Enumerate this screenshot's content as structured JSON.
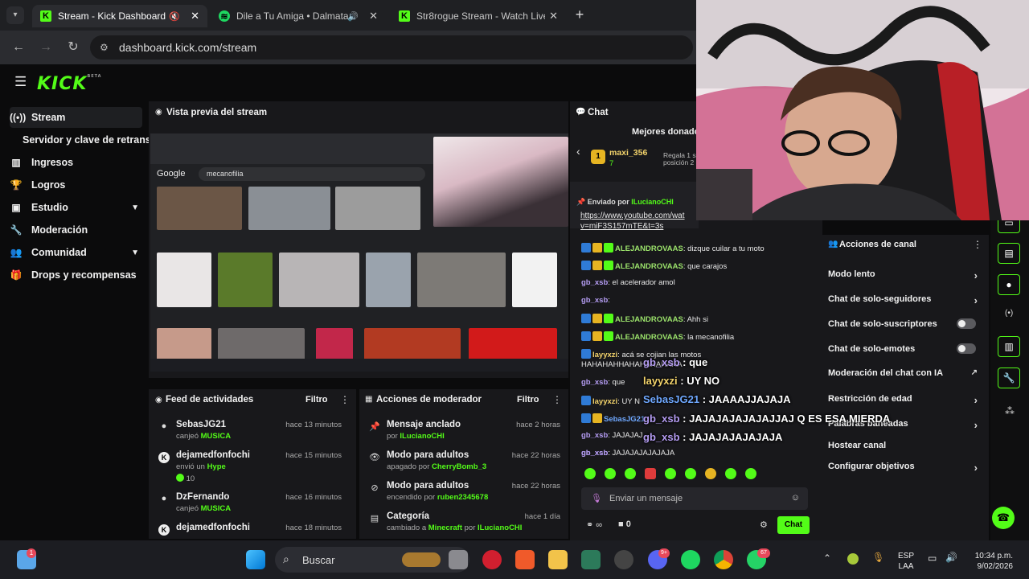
{
  "browser": {
    "tabs": [
      {
        "title": "Stream - Kick Dashboard"
      },
      {
        "title": "Dile a Tu Amiga • Dalmata"
      },
      {
        "title": "Str8rogue Stream - Watch Live"
      }
    ],
    "url": "dashboard.kick.com/stream"
  },
  "kick": {
    "logo": "KICK",
    "logo_beta": "BETA",
    "sidebar": [
      {
        "label": "Stream",
        "icon": "broadcast-icon"
      },
      {
        "label": "Servidor y clave de retransm",
        "icon": ""
      },
      {
        "label": "Ingresos",
        "icon": "chart-icon"
      },
      {
        "label": "Logros",
        "icon": "trophy-icon"
      },
      {
        "label": "Estudio",
        "icon": "monitor-icon"
      },
      {
        "label": "Moderación",
        "icon": "wrench-icon"
      },
      {
        "label": "Comunidad",
        "icon": "people-icon"
      },
      {
        "label": "Drops y recompensas",
        "icon": "gift-icon"
      }
    ],
    "preview": {
      "title": "Vista previa del stream",
      "search_brand": "Google",
      "search_query": "mecanofilia"
    },
    "feed": {
      "title": "Feed de actividades",
      "filter": "Filtro",
      "items": [
        {
          "user": "SebasJG21",
          "action": "canjeó",
          "item": "MUSICA",
          "time": "hace 13 minutos"
        },
        {
          "user": "dejamedfonfochi",
          "action": "envió un",
          "item": "Hype",
          "extra": "10",
          "time": "hace 15 minutos"
        },
        {
          "user": "DzFernando",
          "action": "canjeó",
          "item": "MUSICA",
          "time": "hace 16 minutos"
        },
        {
          "user": "dejamedfonfochi",
          "action": "",
          "item": "",
          "time": "hace 18 minutos"
        }
      ]
    },
    "mod_actions": {
      "title": "Acciones de moderador",
      "filter": "Filtro",
      "items": [
        {
          "title": "Mensaje anclado",
          "prefix": "por",
          "user": "ILucianoCHI",
          "time": "hace 2 horas"
        },
        {
          "title": "Modo para adultos",
          "prefix": "apagado por",
          "user": "CherryBomb_3",
          "time": "hace 22 horas"
        },
        {
          "title": "Modo para adultos",
          "prefix": "encendido por",
          "user": "ruben2345678",
          "time": "hace 22 horas"
        },
        {
          "title": "Categoría",
          "prefix": "cambiado a",
          "user": "Minecraft",
          "prefix2": "por",
          "user2": "ILucianoCHI",
          "time": "hace 1 día"
        }
      ]
    },
    "chat": {
      "title": "Chat",
      "top_donors": "Mejores donador",
      "donor_name": "maxi_356",
      "donor_count": "7",
      "donor_note1": "Regala 1 s",
      "donor_note2": "posición 2",
      "pinned_by": "Enviado por",
      "pinned_user": "ILucianoCHI",
      "pinned_link": "https://www.youtube.com/wat",
      "pinned_link2": "v=miF3S157mTE&t=3s",
      "messages": [
        {
          "user": "ALEJANDROVAAS",
          "text": ": dizque cuilar a tu moto",
          "color": "#9be26b",
          "badges": 3
        },
        {
          "user": "ALEJANDROVAAS",
          "text": ": que carajos",
          "color": "#9be26b",
          "badges": 3
        },
        {
          "user": "gb_xsb",
          "text": ": el acelerador amol",
          "color": "#b49cf2",
          "badges": 0
        },
        {
          "user": "gb_xsb",
          "text": ":",
          "color": "#b49cf2",
          "badges": 0
        },
        {
          "user": "ALEJANDROVAAS",
          "text": ": Ahh si",
          "color": "#9be26b",
          "badges": 3
        },
        {
          "user": "ALEJANDROVAAS",
          "text": ": la mecanofilia",
          "color": "#9be26b",
          "badges": 3
        },
        {
          "user": "layyxzi",
          "text": ": acá se cojian las motos",
          "color": "#f3d36b",
          "badges": 1
        },
        {
          "user": "",
          "text": "HAHAHAHHAHAHAHAHAHA",
          "color": "#ffffff",
          "badges": 0
        },
        {
          "user": "gb_xsb",
          "text": ": que",
          "color": "#b49cf2",
          "badges": 0
        },
        {
          "user": "layyxzi",
          "text": ": UY N",
          "color": "#f3d36b",
          "badges": 1
        },
        {
          "user": "SebasJG21",
          "text": "",
          "color": "#6fa8ff",
          "badges": 2
        },
        {
          "user": "gb_xsb",
          "text": ": JAJAJAJ",
          "color": "#b49cf2",
          "badges": 0
        },
        {
          "user": "gb_xsb",
          "text": ":",
          "color": "#b49cf2",
          "badges": 0
        },
        {
          "user": "gb_xsb",
          "text": ": JAJAJAJAJAJAJA",
          "color": "#b49cf2",
          "badges": 0
        }
      ],
      "overlay": [
        {
          "user": "gb_xsb",
          "text": ": que"
        },
        {
          "user": "layyxzi",
          "text": ": UY NO"
        },
        {
          "user": "SebasJG21",
          "text": ": JAAAAJJAJAJA"
        },
        {
          "user": "gb_xsb",
          "text": ": JAJAJAJAJAJAJJAJ Q ES ESA MIERDA"
        },
        {
          "user": "gb_xsb",
          "text": ": JAJAJAJAJAJAJA"
        }
      ],
      "input_placeholder": "Enviar un mensaje",
      "viewers": "0",
      "send": "Chat"
    },
    "channel_actions": {
      "title": "Acciones de canal",
      "items": [
        {
          "label": "Modo lento",
          "control": "chevron"
        },
        {
          "label": "Chat de solo-seguidores",
          "control": "chevron"
        },
        {
          "label": "Chat de solo-suscriptores",
          "control": "toggle",
          "on": false
        },
        {
          "label": "Chat de solo-emotes",
          "control": "toggle",
          "on": false
        },
        {
          "label": "Moderación del chat con IA",
          "control": "external"
        },
        {
          "label": "Restricción de edad",
          "control": "chevron"
        },
        {
          "label": "Palabras baneadas",
          "control": "chevron"
        },
        {
          "label": "Hostear canal",
          "control": "none"
        },
        {
          "label": "Configurar objetivos",
          "control": "chevron"
        }
      ]
    }
  },
  "taskbar": {
    "search": "Buscar",
    "lang1": "ESP",
    "lang2": "LAA",
    "time": "10:34 p.m.",
    "date": "9/02/2026",
    "badge_notif": "1",
    "badge_whatsapp": "67",
    "badge_discord": "9+"
  },
  "colors": {
    "accent": "#53fc18",
    "panel": "#18181b",
    "bg": "#0b0b0c"
  }
}
